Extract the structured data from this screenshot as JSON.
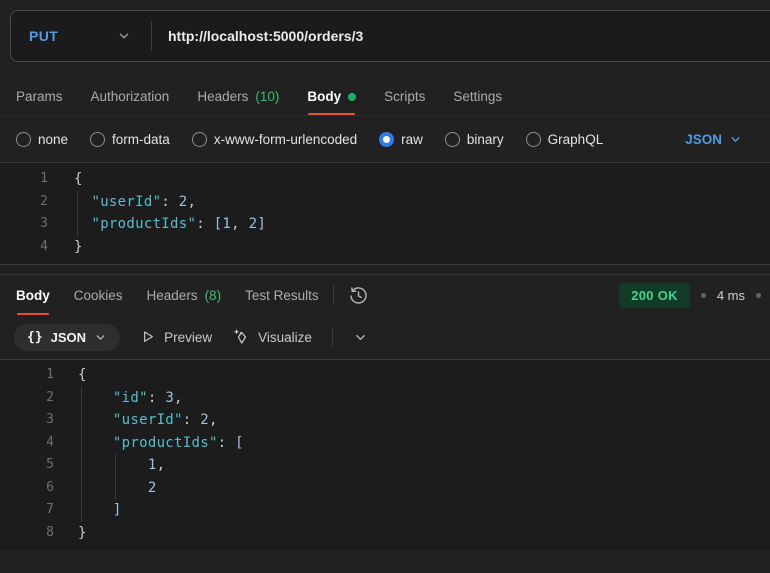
{
  "colors": {
    "accent_orange": "#e0562c",
    "method_blue": "#4e9ae6",
    "count_green": "#3bbd6e",
    "status_green": "#41d590",
    "status_badge_bg": "#123b27",
    "key_cyan": "#53bfcd",
    "number_blue": "#a3c1de"
  },
  "request": {
    "method": "PUT",
    "url": "http://localhost:5000/orders/3",
    "tabs": [
      {
        "label": "Params"
      },
      {
        "label": "Authorization"
      },
      {
        "label": "Headers",
        "count": "(10)"
      },
      {
        "label": "Body",
        "active": true,
        "unsaved_dot": true
      },
      {
        "label": "Scripts"
      },
      {
        "label": "Settings"
      }
    ],
    "body_modes": {
      "options": [
        "none",
        "form-data",
        "x-www-form-urlencoded",
        "raw",
        "binary",
        "GraphQL"
      ],
      "selected": "raw",
      "language": "JSON"
    },
    "editor_lines": [
      {
        "num": "1",
        "segments": [
          {
            "t": "{",
            "c": "brace"
          }
        ]
      },
      {
        "num": "2",
        "segments": [
          {
            "t": "  ",
            "c": "punc"
          },
          {
            "t": "\"userId\"",
            "c": "key"
          },
          {
            "t": ": ",
            "c": "punc"
          },
          {
            "t": "2",
            "c": "num"
          },
          {
            "t": ",",
            "c": "punc"
          }
        ]
      },
      {
        "num": "3",
        "segments": [
          {
            "t": "  ",
            "c": "punc"
          },
          {
            "t": "\"productIds\"",
            "c": "key"
          },
          {
            "t": ": ",
            "c": "punc"
          },
          {
            "t": "[",
            "c": "num"
          },
          {
            "t": "1",
            "c": "num"
          },
          {
            "t": ", ",
            "c": "punc"
          },
          {
            "t": "2",
            "c": "num"
          },
          {
            "t": "]",
            "c": "num"
          }
        ]
      },
      {
        "num": "4",
        "segments": [
          {
            "t": "}",
            "c": "brace"
          }
        ]
      }
    ]
  },
  "response": {
    "tabs": [
      {
        "label": "Body",
        "active": true
      },
      {
        "label": "Cookies"
      },
      {
        "label": "Headers",
        "count": "(8)"
      },
      {
        "label": "Test Results"
      }
    ],
    "status": {
      "code_text": "200 OK",
      "time": "4 ms"
    },
    "view": {
      "format": "JSON",
      "preview_label": "Preview",
      "visualize_label": "Visualize"
    },
    "editor_lines": [
      {
        "num": "1",
        "segments": [
          {
            "t": "{",
            "c": "brace"
          }
        ]
      },
      {
        "num": "2",
        "segments": [
          {
            "t": "    ",
            "c": "punc"
          },
          {
            "t": "\"id\"",
            "c": "key"
          },
          {
            "t": ": ",
            "c": "punc"
          },
          {
            "t": "3",
            "c": "num"
          },
          {
            "t": ",",
            "c": "punc"
          }
        ]
      },
      {
        "num": "3",
        "segments": [
          {
            "t": "    ",
            "c": "punc"
          },
          {
            "t": "\"userId\"",
            "c": "key"
          },
          {
            "t": ": ",
            "c": "punc"
          },
          {
            "t": "2",
            "c": "num"
          },
          {
            "t": ",",
            "c": "punc"
          }
        ]
      },
      {
        "num": "4",
        "segments": [
          {
            "t": "    ",
            "c": "punc"
          },
          {
            "t": "\"productIds\"",
            "c": "key"
          },
          {
            "t": ": ",
            "c": "punc"
          },
          {
            "t": "[",
            "c": "num"
          }
        ]
      },
      {
        "num": "5",
        "segments": [
          {
            "t": "        ",
            "c": "punc"
          },
          {
            "t": "1",
            "c": "num"
          },
          {
            "t": ",",
            "c": "punc"
          }
        ]
      },
      {
        "num": "6",
        "segments": [
          {
            "t": "        ",
            "c": "punc"
          },
          {
            "t": "2",
            "c": "num"
          }
        ]
      },
      {
        "num": "7",
        "segments": [
          {
            "t": "    ",
            "c": "punc"
          },
          {
            "t": "]",
            "c": "num"
          }
        ]
      },
      {
        "num": "8",
        "segments": [
          {
            "t": "}",
            "c": "brace"
          }
        ]
      }
    ]
  }
}
